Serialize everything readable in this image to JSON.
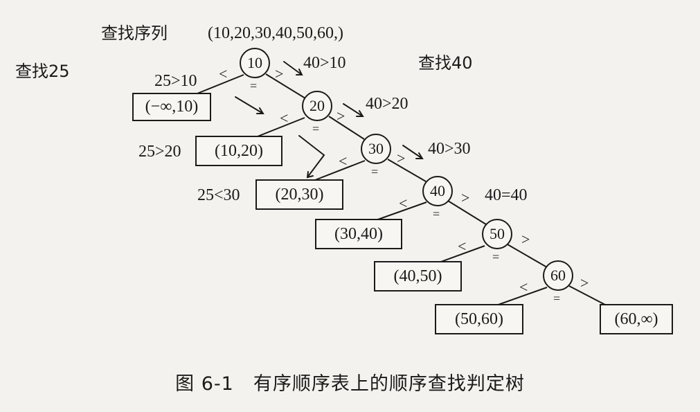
{
  "header": {
    "sequence_label": "查找序列",
    "sequence_value": "(10,20,30,40,50,60,)",
    "left_search_label": "查找25",
    "right_search_label": "查找40"
  },
  "nodes": [
    "10",
    "20",
    "30",
    "40",
    "50",
    "60"
  ],
  "intervals": [
    "(−∞,10)",
    "(10,20)",
    "(20,30)",
    "(30,40)",
    "(40,50)",
    "(50,60)",
    "(60,∞)"
  ],
  "left_path_labels": [
    "25>10",
    "25>20",
    "25<30"
  ],
  "right_path_labels": [
    "40>10",
    "40>20",
    "40>30",
    "40=40"
  ],
  "symbols": {
    "less": "<",
    "greater": ">",
    "equal": "="
  },
  "caption": "图 6-1　有序顺序表上的顺序查找判定树"
}
